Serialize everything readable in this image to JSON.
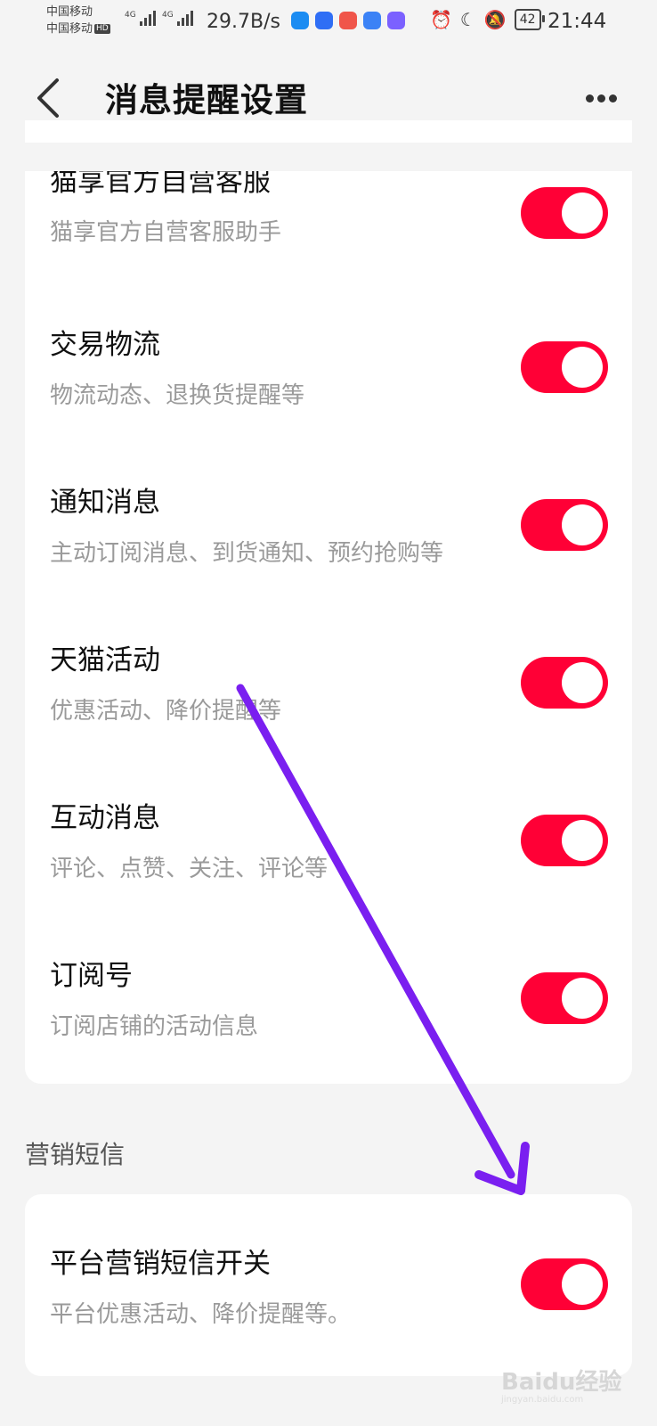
{
  "status_bar": {
    "carrier_1": "中国移动",
    "carrier_2": "中国移动",
    "hd_badge": "HD",
    "net_1": "4G",
    "net_2": "4G",
    "speed": "29.7B/s",
    "battery": "42",
    "time": "21:44",
    "app_icon_colors": [
      "#1b8cf2",
      "#2f6ef5",
      "#f0554a",
      "#3b82f6",
      "#7b61ff"
    ]
  },
  "header": {
    "back_icon": "chevron-left-icon",
    "title": "消息提醒设置",
    "more_icon": "more-dots-icon"
  },
  "settings": {
    "items": [
      {
        "title": "猫享官方自营客服",
        "subtitle": "猫享官方自营客服助手",
        "enabled": true
      },
      {
        "title": "交易物流",
        "subtitle": "物流动态、退换货提醒等",
        "enabled": true
      },
      {
        "title": "通知消息",
        "subtitle": "主动订阅消息、到货通知、预约抢购等",
        "enabled": true
      },
      {
        "title": "天猫活动",
        "subtitle": "优惠活动、降价提醒等",
        "enabled": true
      },
      {
        "title": "互动消息",
        "subtitle": "评论、点赞、关注、评论等",
        "enabled": true
      },
      {
        "title": "订阅号",
        "subtitle": "订阅店铺的活动信息",
        "enabled": true
      }
    ]
  },
  "marketing": {
    "section_label": "营销短信",
    "item": {
      "title": "平台营销短信开关",
      "subtitle": "平台优惠活动、降价提醒等。",
      "enabled": true
    }
  },
  "watermark": {
    "text": "Baidu经验",
    "url": "jingyan.baidu.com"
  },
  "colors": {
    "toggle_on": "#ff0036",
    "background": "#f4f4f4",
    "card": "#ffffff",
    "annotation_arrow": "#7a1ff0"
  }
}
